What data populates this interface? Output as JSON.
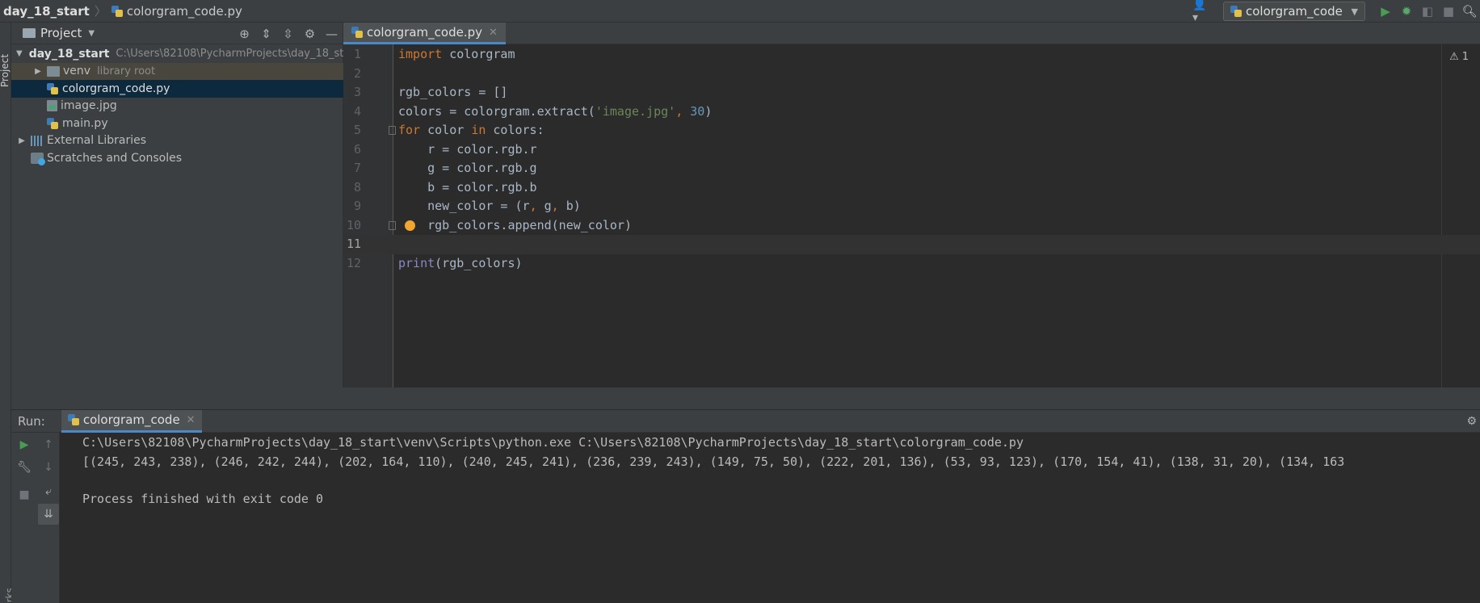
{
  "navbar": {
    "project": "day_18_start",
    "file": "colorgram_code.py",
    "run_config": "colorgram_code"
  },
  "left_strip": {
    "project_label": "Project",
    "bookmarks_label": "arks"
  },
  "project_panel": {
    "title": "Project",
    "tree": [
      {
        "name": "day_18_start",
        "hint": "C:\\Users\\82108\\PycharmProjects\\day_18_start",
        "expanded": true
      },
      {
        "name": "venv",
        "hint": "library root"
      },
      {
        "name": "colorgram_code.py"
      },
      {
        "name": "image.jpg"
      },
      {
        "name": "main.py"
      },
      {
        "name": "External Libraries"
      },
      {
        "name": "Scratches and Consoles"
      }
    ]
  },
  "editor": {
    "tab": "colorgram_code.py",
    "warning_count": "1",
    "line_numbers": [
      "1",
      "2",
      "3",
      "4",
      "5",
      "6",
      "7",
      "8",
      "9",
      "10",
      "11",
      "12"
    ]
  },
  "run_panel": {
    "label": "Run:",
    "tab": "colorgram_code",
    "output": [
      "C:\\Users\\82108\\PycharmProjects\\day_18_start\\venv\\Scripts\\python.exe C:\\Users\\82108\\PycharmProjects\\day_18_start\\colorgram_code.py",
      "[(245, 243, 238), (246, 242, 244), (202, 164, 110), (240, 245, 241), (236, 239, 243), (149, 75, 50), (222, 201, 136), (53, 93, 123), (170, 154, 41), (138, 31, 20), (134, 163",
      "",
      "Process finished with exit code 0"
    ]
  },
  "colors": {
    "background": "#2b2b2b",
    "panel": "#3c3f41",
    "selection": "#0d293e",
    "keyword": "#cc7832",
    "string": "#6a8759",
    "number": "#6897bb",
    "run_green": "#499c54"
  },
  "icons": [
    "user-icon",
    "play-icon",
    "debug-icon",
    "coverage-icon",
    "stop-icon",
    "search-icon",
    "locate-icon",
    "expand-all-icon",
    "collapse-all-icon",
    "gear-icon",
    "minimize-icon",
    "lightbulb-icon",
    "warning-icon",
    "wrench-icon",
    "soft-wrap-icon"
  ]
}
